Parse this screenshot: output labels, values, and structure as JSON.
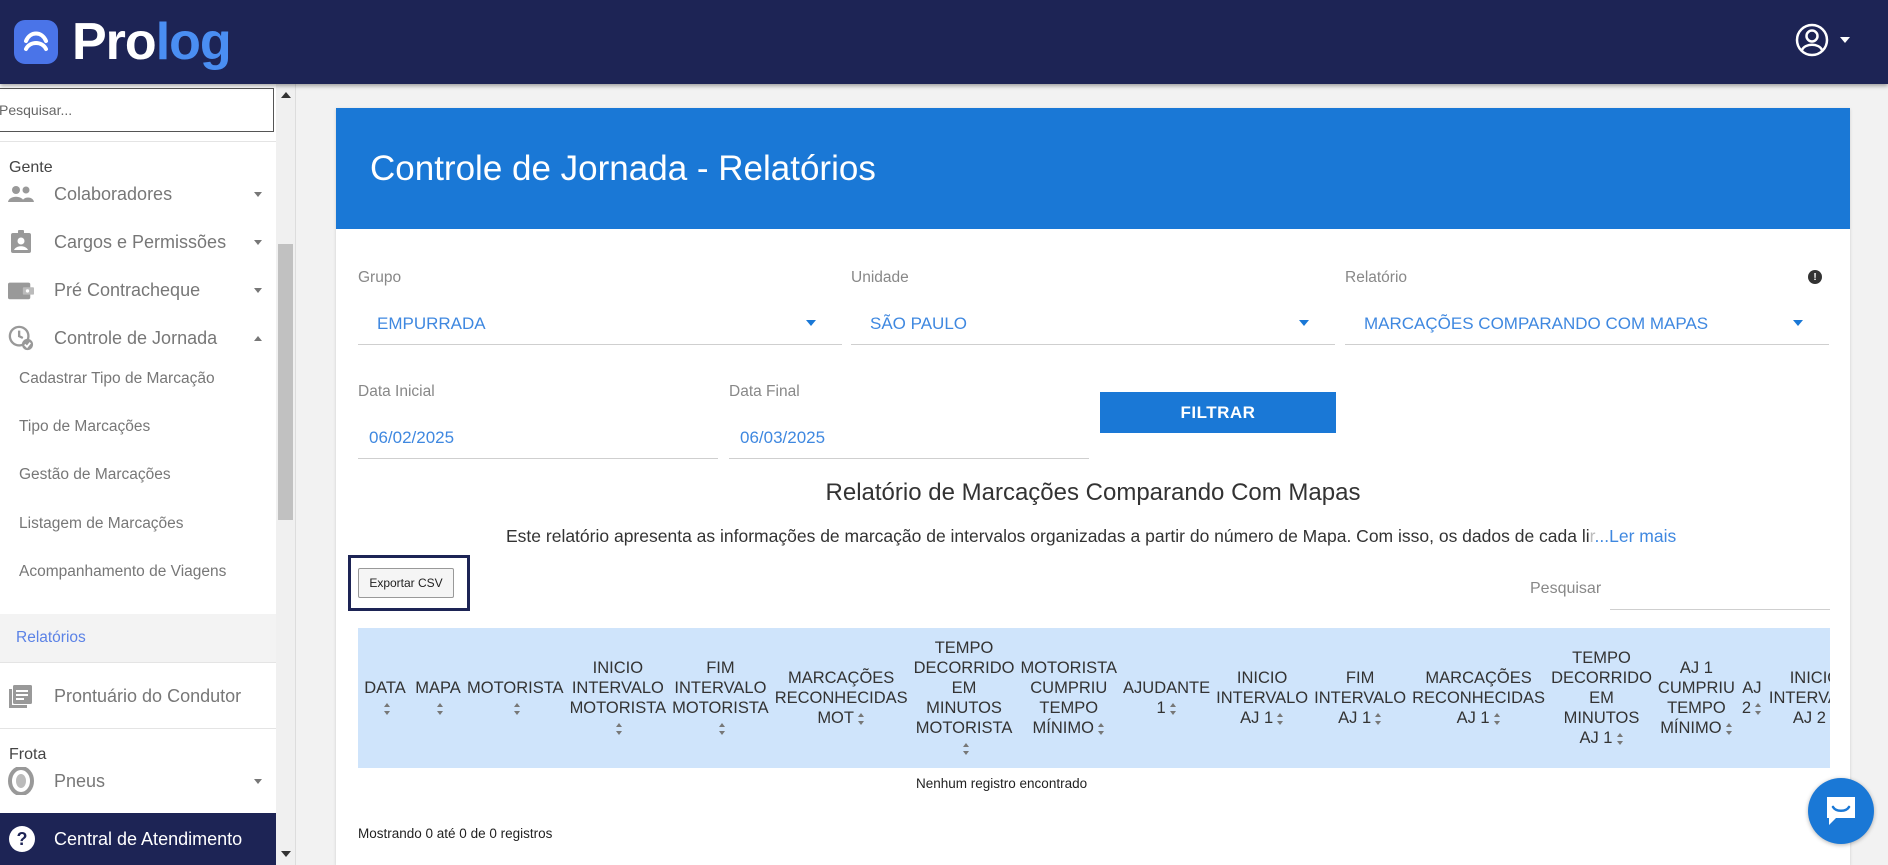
{
  "app": {
    "logo_part1": "Pro",
    "logo_part2": "log",
    "brand_color": "#1d2455",
    "accent_color": "#1a78d6"
  },
  "sidebar": {
    "search_placeholder": "Pesquisar...",
    "section_gente": "Gente",
    "items": {
      "colaboradores": "Colaboradores",
      "cargos": "Cargos e Permissões",
      "contracheque": "Pré Contracheque",
      "jornada": "Controle de Jornada",
      "prontuario": "Prontuário do Condutor",
      "pneus": "Pneus"
    },
    "subitems": {
      "cadastrar": "Cadastrar Tipo de Marcação",
      "tipo": "Tipo de Marcações",
      "gestao": "Gestão de Marcações",
      "listagem": "Listagem de Marcações",
      "acompanhamento": "Acompanhamento de Viagens",
      "relatorios": "Relatórios"
    },
    "section_frota": "Frota",
    "central": "Central de Atendimento"
  },
  "page": {
    "title": "Controle de Jornada - Relatórios",
    "filters": {
      "grupo_label": "Grupo",
      "grupo_value": "EMPURRADA",
      "unidade_label": "Unidade",
      "unidade_value": "SÃO PAULO",
      "relatorio_label": "Relatório",
      "relatorio_value": "MARCAÇÕES COMPARANDO COM MAPAS",
      "data_inicial_label": "Data Inicial",
      "data_inicial_value": "06/02/2025",
      "data_final_label": "Data Final",
      "data_final_value": "06/03/2025",
      "filtrar": "FILTRAR"
    },
    "report": {
      "title": "Relatório de Marcações Comparando Com Mapas",
      "description": "Este relatório apresenta as informações de marcação de intervalos organizadas a partir do número de Mapa. Com isso, os dados de cada li",
      "description_fade": "r",
      "read_more": "...Ler mais",
      "export_csv": "Exportar CSV",
      "search_label": "Pesquisar",
      "columns": [
        [
          "DATA"
        ],
        [
          "MAPA"
        ],
        [
          "MOTORISTA"
        ],
        [
          "INICIO",
          "INTERVALO",
          "MOTORISTA"
        ],
        [
          "FIM",
          "INTERVALO",
          "MOTORISTA"
        ],
        [
          "MARCAÇÕES",
          "RECONHECIDAS",
          "MOT"
        ],
        [
          "TEMPO",
          "DECORRIDO",
          "EM",
          "MINUTOS",
          "MOTORISTA"
        ],
        [
          "MOTORISTA",
          "CUMPRIU",
          "TEMPO",
          "MÍNIMO"
        ],
        [
          "AJUDANTE",
          "1"
        ],
        [
          "INICIO",
          "INTERVALO",
          "AJ 1"
        ],
        [
          "FIM",
          "INTERVALO",
          "AJ 1"
        ],
        [
          "MARCAÇÕES",
          "RECONHECIDAS",
          "AJ 1"
        ],
        [
          "TEMPO",
          "DECORRIDO",
          "EM",
          "MINUTOS",
          "AJ 1"
        ],
        [
          "AJ 1",
          "CUMPRIU",
          "TEMPO",
          "MÍNIMO"
        ],
        [
          "AJ",
          "2"
        ],
        [
          "INICIO",
          "INTERVALO",
          "AJ 2"
        ]
      ],
      "empty_text": "Nenhum registro encontrado",
      "entries_text": "Mostrando 0 até 0 de 0 registros"
    }
  }
}
